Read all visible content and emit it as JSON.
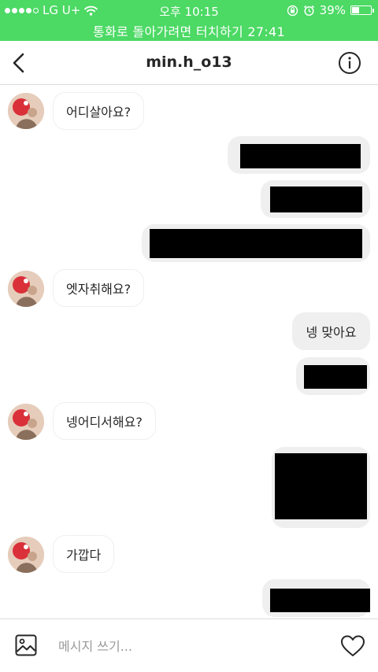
{
  "status_bar": {
    "carrier": "LG U+",
    "signal_bars_filled": 4,
    "signal_bars_total": 5,
    "time": "오후 10:15",
    "battery": "39%",
    "battery_level": 0.39,
    "call_return": "통화로 돌아가려면 터치하기 27:41",
    "background_color": "#4cd964"
  },
  "header": {
    "title": "min.h_o13",
    "back_icon": "chevron-left-icon",
    "info_icon": "info-icon"
  },
  "messages": [
    {
      "from": "them",
      "text": "어디살아요?"
    },
    {
      "from": "me",
      "redacted": true
    },
    {
      "from": "me",
      "redacted": true
    },
    {
      "from": "me",
      "redacted": true
    },
    {
      "from": "them",
      "text": "엣자취해요?"
    },
    {
      "from": "me",
      "text": "넹 맞아요"
    },
    {
      "from": "me",
      "redacted": true
    },
    {
      "from": "them",
      "text": "넹어디서해요?"
    },
    {
      "from": "me",
      "redacted": true
    },
    {
      "from": "them",
      "text": "가깝다"
    },
    {
      "from": "me",
      "redacted": true
    }
  ],
  "composer": {
    "placeholder": "메시지 쓰기...",
    "gallery_icon": "gallery-icon",
    "like_icon": "heart-icon"
  }
}
